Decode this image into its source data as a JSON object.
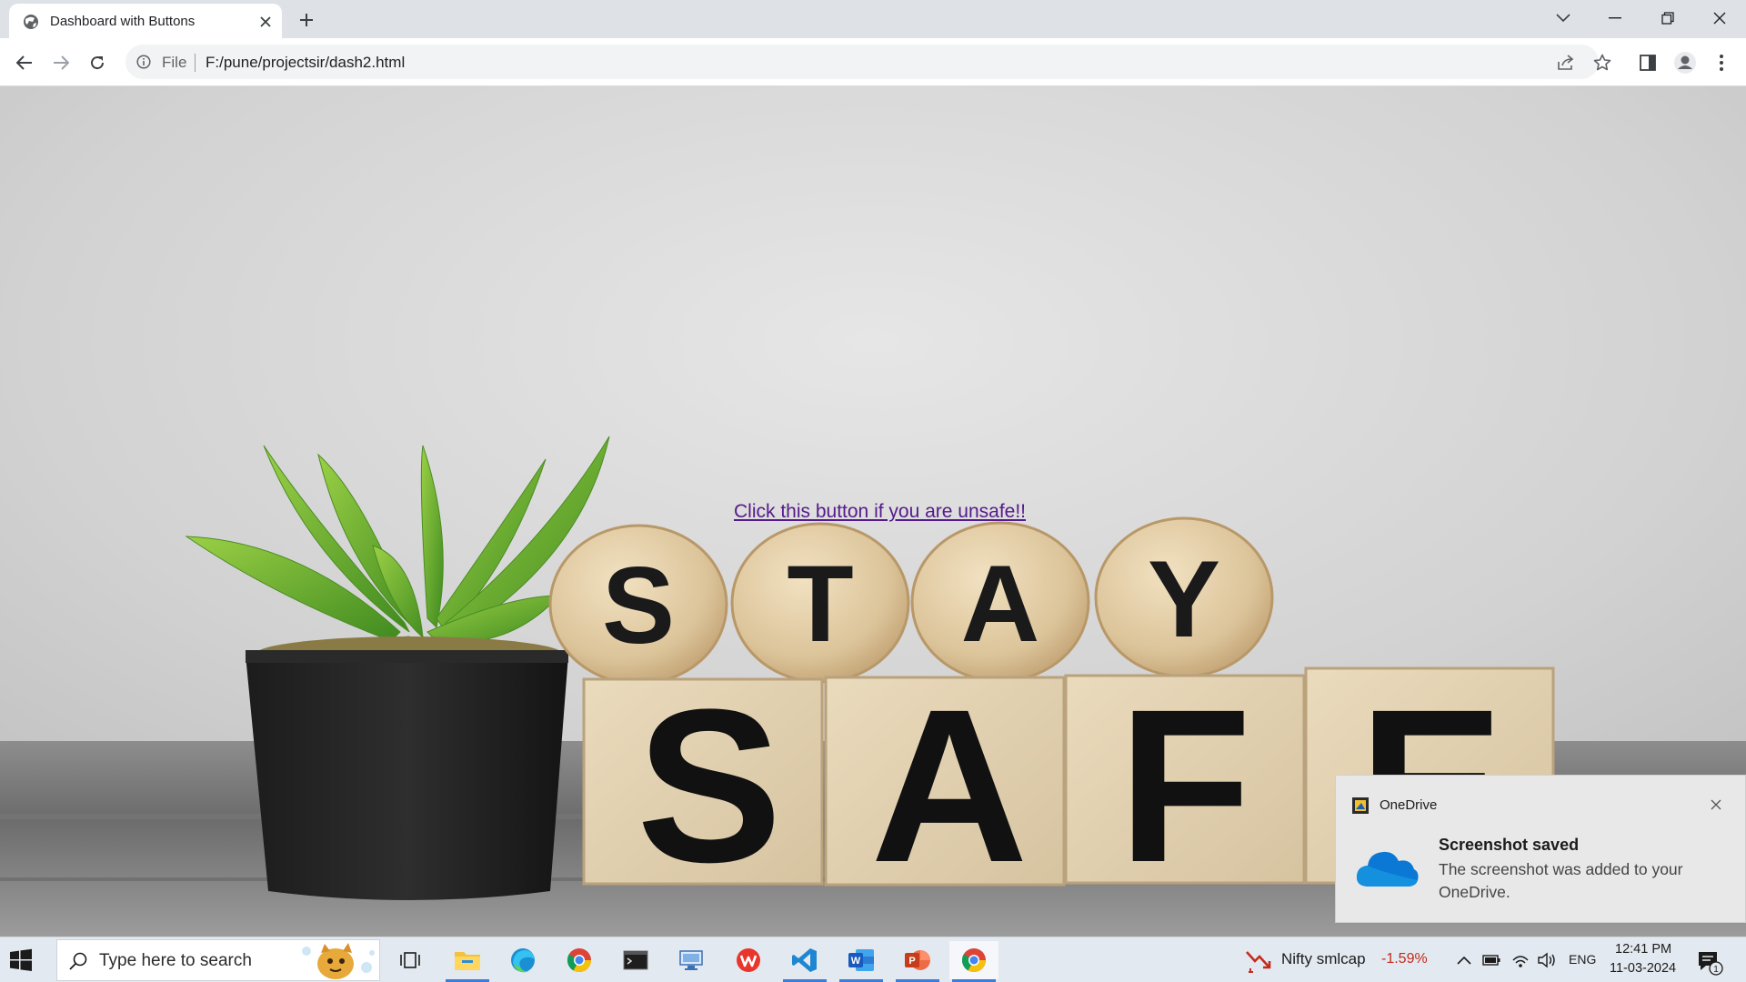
{
  "browser": {
    "tab_title": "Dashboard with Buttons",
    "omnibox_scheme": "File",
    "url": "F:/pune/projectsir/dash2.html"
  },
  "page": {
    "link_text": "Click this button if you are unsafe!!",
    "picture_top_row": [
      "S",
      "T",
      "A",
      "Y"
    ],
    "picture_bottom_row": [
      "S",
      "A",
      "F",
      "E"
    ]
  },
  "toast": {
    "app_name": "OneDrive",
    "title": "Screenshot saved",
    "body": "The screenshot was added to your OneDrive."
  },
  "taskbar": {
    "search_placeholder": "Type here to search",
    "stock_name": "Nifty smlcap",
    "stock_change": "-1.59%",
    "language": "ENG",
    "time": "12:41 PM",
    "date": "11-03-2024",
    "notification_count": "1"
  },
  "colors": {
    "link": "#551a8b",
    "stock_negative": "#c42b1c",
    "onedrive_blue": "#0a78d4"
  }
}
